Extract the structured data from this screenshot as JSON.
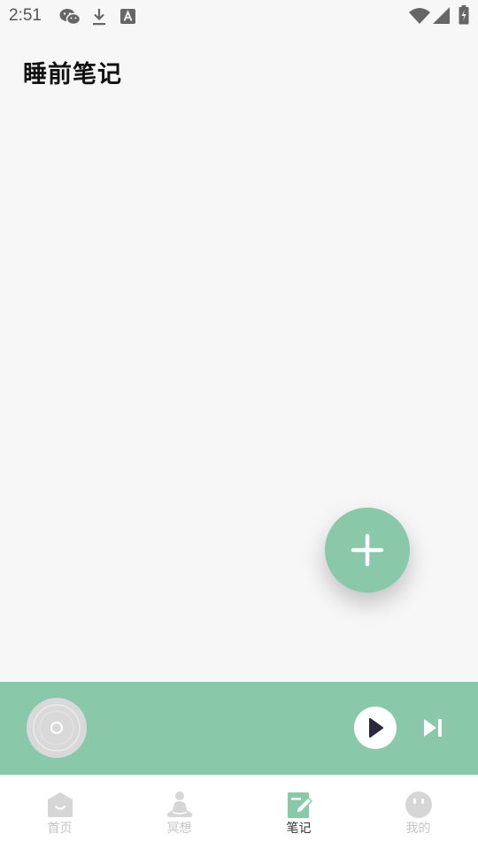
{
  "status_bar": {
    "time": "2:51",
    "icons": [
      "wechat-icon",
      "download-icon",
      "a-badge-icon",
      "wifi-icon",
      "signal-icon",
      "battery-charging-icon"
    ]
  },
  "page": {
    "title": "睡前笔记"
  },
  "fab": {
    "icon": "plus-icon",
    "color": "#89c8a9"
  },
  "player": {
    "background": "#89c8a9",
    "cover_icon": "disc-icon",
    "play_icon": "play-icon",
    "next_icon": "skip-next-icon"
  },
  "tabs": [
    {
      "label": "首页",
      "icon": "home-icon",
      "active": false
    },
    {
      "label": "冥想",
      "icon": "meditation-icon",
      "active": false
    },
    {
      "label": "笔记",
      "icon": "note-icon",
      "active": true
    },
    {
      "label": "我的",
      "icon": "smiley-icon",
      "active": false
    }
  ],
  "colors": {
    "accent": "#89c8a9",
    "inactive_tab": "#c4c4c4",
    "active_tab_text": "#333333"
  }
}
